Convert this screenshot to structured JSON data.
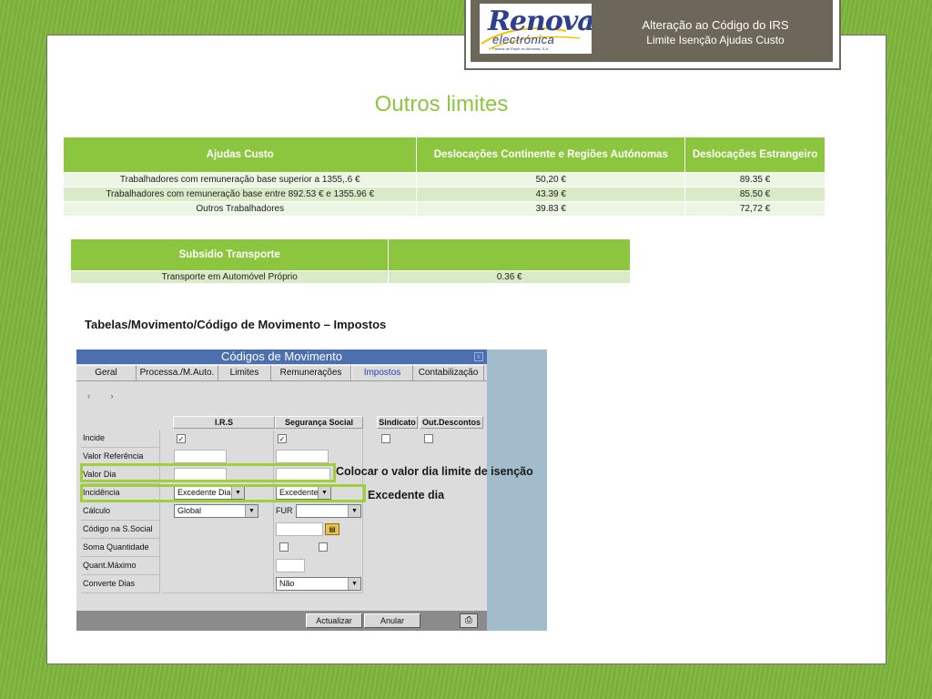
{
  "header": {
    "logo_text": "Renova",
    "logo_sub": "electrónica",
    "logo_tiny": "Fábrica de Papel do Almonda, S.A.",
    "title": "Alteração ao Código do IRS",
    "subtitle": "Limite Isenção Ajudas Custo"
  },
  "page_title": "Outros limites",
  "table1": {
    "headers": [
      "Ajudas Custo",
      "Deslocações Continente e Regiões Autónomas",
      "Deslocações Estrangeiro"
    ],
    "rows": [
      [
        "Trabalhadores com remuneração base superior a 1355,.6 €",
        "50,20 €",
        "89.35 €"
      ],
      [
        "Trabalhadores com remuneração base entre 892.53 € e  1355.96 €",
        "43.39 €",
        "85.50 €"
      ],
      [
        "Outros Trabalhadores",
        "39.83 €",
        "72,72 €"
      ]
    ]
  },
  "table2": {
    "headers": [
      "Subsidio Transporte",
      ""
    ],
    "rows": [
      [
        "Transporte em Automóvel Próprio",
        "0.36 €"
      ]
    ]
  },
  "path_label": "Tabelas/Movimento/Código de Movimento  – Impostos",
  "app": {
    "title": "Códigos de Movimento",
    "close_glyph": "x",
    "tabs": [
      "Geral",
      "Processa./M.Auto.",
      "Limites",
      "Remunerações",
      "Impostos",
      "Contabilização"
    ],
    "active_tab": "Impostos",
    "nav_arrows": "‹ ›",
    "columns": [
      "I.R.S",
      "Segurança Social",
      "Sindicato",
      "Out.Descontos"
    ],
    "rows": [
      "Incide",
      "Valor Referência",
      "Valor Dia",
      "Incidência",
      "Cálculo",
      "Código na S.Social",
      "Soma Quantidade",
      "Quant.Máximo",
      "Converte Dias"
    ],
    "checked_mark": "✓",
    "irs_incidencia": "Excedente Dia",
    "ss_incidencia": "Excedente",
    "irs_calculo": "Global",
    "ss_calculo": "FUR",
    "converte_dias": "Não",
    "buttons": [
      "Actualizar",
      "Anular"
    ]
  },
  "callouts": {
    "valor_dia": "Colocar o valor dia limite de isenção",
    "excedente": "Excedente dia"
  },
  "colors": {
    "accent": "#8cc63f",
    "header_bg": "#6d6759",
    "highlight": "#9fd03a"
  }
}
